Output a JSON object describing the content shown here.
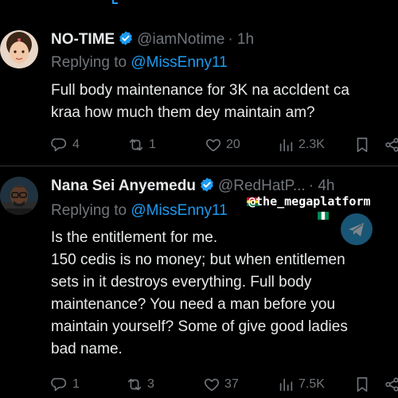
{
  "tweets": [
    {
      "name": "NO-TIME",
      "handle": "@iamNotime",
      "time": "· 1h",
      "replying_prefix": "Replying to ",
      "replying_to": "@MissEnny11",
      "lines": [
        "Full body maintenance for 3K na accldent ca",
        "kraa how much them dey maintain am?"
      ],
      "stats": {
        "replies": "4",
        "retweets": "1",
        "likes": "20",
        "views": "2.3K"
      }
    },
    {
      "name": "Nana Sei Anyemedu",
      "handle": "@RedHatP...",
      "time": "· 4h",
      "replying_prefix": "Replying to ",
      "replying_to": "@MissEnny11",
      "lines": [
        "Is the entitlement for me.",
        "150 cedis is no money; but when entitlemen",
        "sets in it destroys everything. Full body",
        "maintenance? You need a man before you",
        "maintain yourself? Some of give good ladies",
        "bad name."
      ],
      "stats": {
        "replies": "1",
        "retweets": "3",
        "likes": "37",
        "views": "7.5K"
      }
    }
  ],
  "watermark": {
    "text": "@the_megaplatform"
  },
  "icons": {
    "verified": "verified-badge-icon",
    "reply": "reply-icon",
    "retweet": "retweet-icon",
    "like": "heart-icon",
    "views": "views-icon",
    "bookmark": "bookmark-icon",
    "share": "share-icon"
  },
  "colors": {
    "background": "#000000",
    "text": "#e7e9ea",
    "muted": "#71767b",
    "accent": "#1d9bf0",
    "divider": "#2f3336"
  }
}
